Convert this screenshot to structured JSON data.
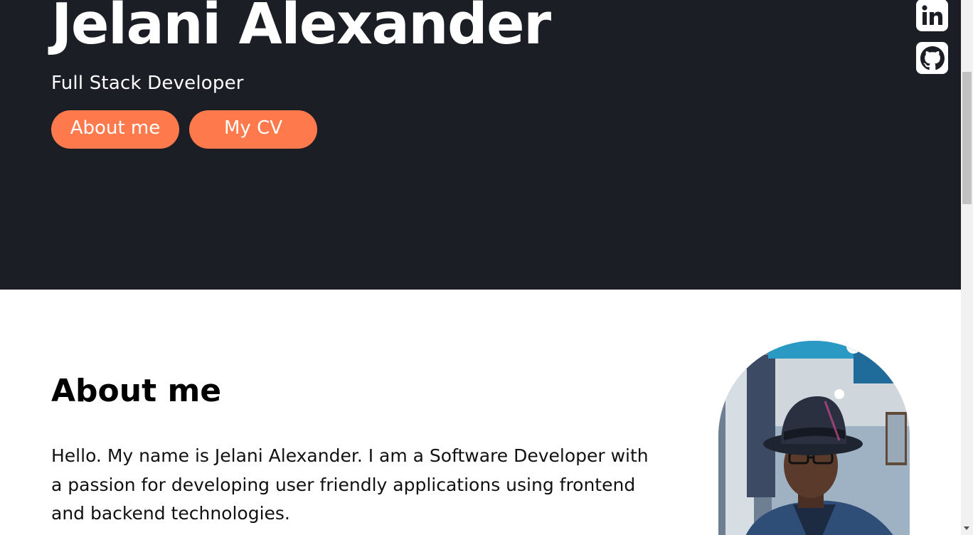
{
  "hero": {
    "name": "Jelani Alexander",
    "role": "Full Stack Developer",
    "buttons": {
      "about_label": "About me",
      "cv_label": "My CV"
    },
    "social": {
      "linkedin_icon": "linkedin-icon",
      "github_icon": "github-icon"
    }
  },
  "about": {
    "title": "About me",
    "text": "Hello. My name is Jelani Alexander. I am a Software Developer with a passion for developing user friendly applications using frontend and backend technologies."
  },
  "colors": {
    "hero_background": "#1c1e26",
    "accent": "#fe7a4d",
    "text_light": "#ffffff",
    "text_dark": "#000000"
  },
  "icons": [
    "linkedin-icon",
    "github-icon",
    "scroll-down-arrow-icon"
  ]
}
